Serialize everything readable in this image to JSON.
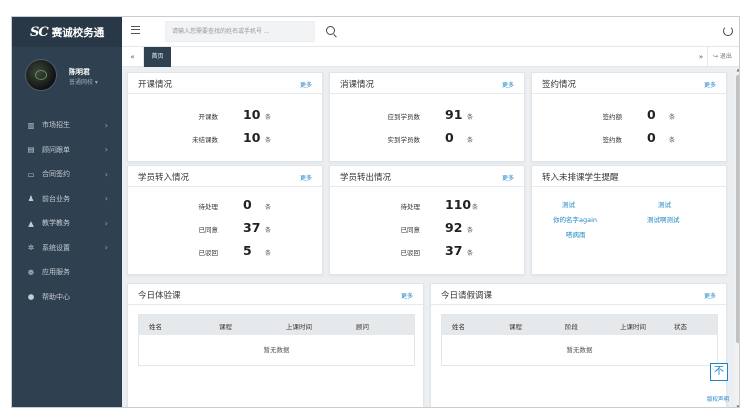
{
  "app": {
    "logo_mark": "SC",
    "name": "赛诚校务通"
  },
  "user": {
    "name": "陈明君",
    "role": "普通网校 ▾"
  },
  "sidebar": {
    "items": [
      {
        "icon": "chart-icon",
        "glyph": "▥",
        "label": "市场招生"
      },
      {
        "icon": "document-icon",
        "glyph": "▤",
        "label": "顾问跟单"
      },
      {
        "icon": "contract-icon",
        "glyph": "▭",
        "label": "合同签约"
      },
      {
        "icon": "users-icon",
        "glyph": "♟",
        "label": "前台业务"
      },
      {
        "icon": "graduation-cap-icon",
        "glyph": "▲",
        "label": "教学教务"
      },
      {
        "icon": "gears-icon",
        "glyph": "✲",
        "label": "系统设置"
      },
      {
        "icon": "apps-icon",
        "glyph": "❁",
        "label": "应用服务"
      },
      {
        "icon": "help-icon",
        "glyph": "●",
        "label": "帮助中心"
      }
    ]
  },
  "search": {
    "placeholder": "请输入您需要查找的姓名或手机号 ..."
  },
  "tabs": {
    "prev": "«",
    "active": "首页",
    "next": "»",
    "logout": "↪ 退出"
  },
  "more_label": "更多",
  "cards": {
    "course": {
      "title": "开课情况",
      "rows": [
        {
          "label": "开课数",
          "value": "10",
          "unit": "条"
        },
        {
          "label": "未结课数",
          "value": "10",
          "unit": "条"
        }
      ]
    },
    "consume": {
      "title": "消课情况",
      "rows": [
        {
          "label": "应到学员数",
          "value": "91",
          "unit": "条"
        },
        {
          "label": "实到学员数",
          "value": "0",
          "unit": "条"
        }
      ]
    },
    "sign": {
      "title": "签约情况",
      "rows": [
        {
          "label": "签约额",
          "value": "0",
          "unit": "条"
        },
        {
          "label": "签约数",
          "value": "0",
          "unit": "条"
        }
      ]
    },
    "transfer_in": {
      "title": "学员转入情况",
      "rows": [
        {
          "label": "待处理",
          "value": "0",
          "unit": "条"
        },
        {
          "label": "已同意",
          "value": "37",
          "unit": "条"
        },
        {
          "label": "已驳回",
          "value": "5",
          "unit": "条"
        }
      ]
    },
    "transfer_out": {
      "title": "学员转出情况",
      "rows": [
        {
          "label": "待处理",
          "value": "110",
          "unit": "条"
        },
        {
          "label": "已同意",
          "value": "92",
          "unit": "条"
        },
        {
          "label": "已驳回",
          "value": "37",
          "unit": "条"
        }
      ]
    },
    "unscheduled": {
      "title": "转入未排课学生提醒",
      "links": [
        "测试",
        "测试",
        "你的名字again",
        "测试啊测试",
        "嗒病雨"
      ]
    },
    "trial": {
      "title": "今日体验课",
      "columns": [
        "姓名",
        "课程",
        "上课时间",
        "顾问"
      ],
      "empty": "暂无数据"
    },
    "leave": {
      "title": "今日请假调课",
      "columns": [
        "姓名",
        "课程",
        "阶段",
        "上课时间",
        "状态"
      ],
      "empty": "暂无数据"
    }
  },
  "to_top": "不",
  "copyright": "版权声明"
}
